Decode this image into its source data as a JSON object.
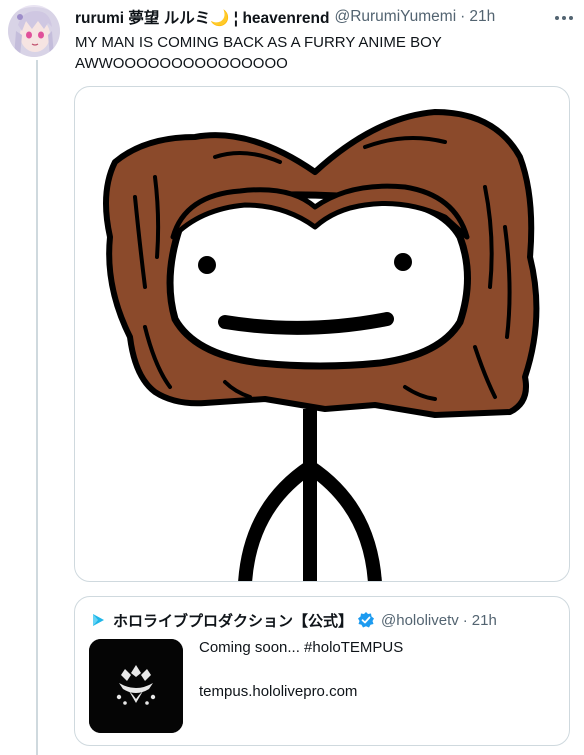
{
  "tweet": {
    "display_name": "rurumi 夢望 ルルミ🌙 ¦ heavenrend",
    "handle": "@RurumiYumemi",
    "separator": "·",
    "time": "21h",
    "text_line1": "MY MAN IS COMING BACK AS A FURRY ANIME BOY",
    "text_line2": "AWWOOOOOOOOOOOOOOO",
    "more_icon": "more-horizontal-icon"
  },
  "media": {
    "description_icon": "stick-figure-drawing",
    "hair_color": "#8b4a2b"
  },
  "quote": {
    "display_name": "ホロライブプロダクション【公式】",
    "handle": "@hololivetv",
    "separator": "·",
    "time": "21h",
    "text": "Coming soon... #holoTEMPUS",
    "link": "tempus.hololivepro.com",
    "verified_icon": "verified-badge-icon",
    "verified_color": "#1d9bf0",
    "avatar_icon": "hololive-triangle-icon",
    "avatar_color": "#1fb6e8"
  }
}
